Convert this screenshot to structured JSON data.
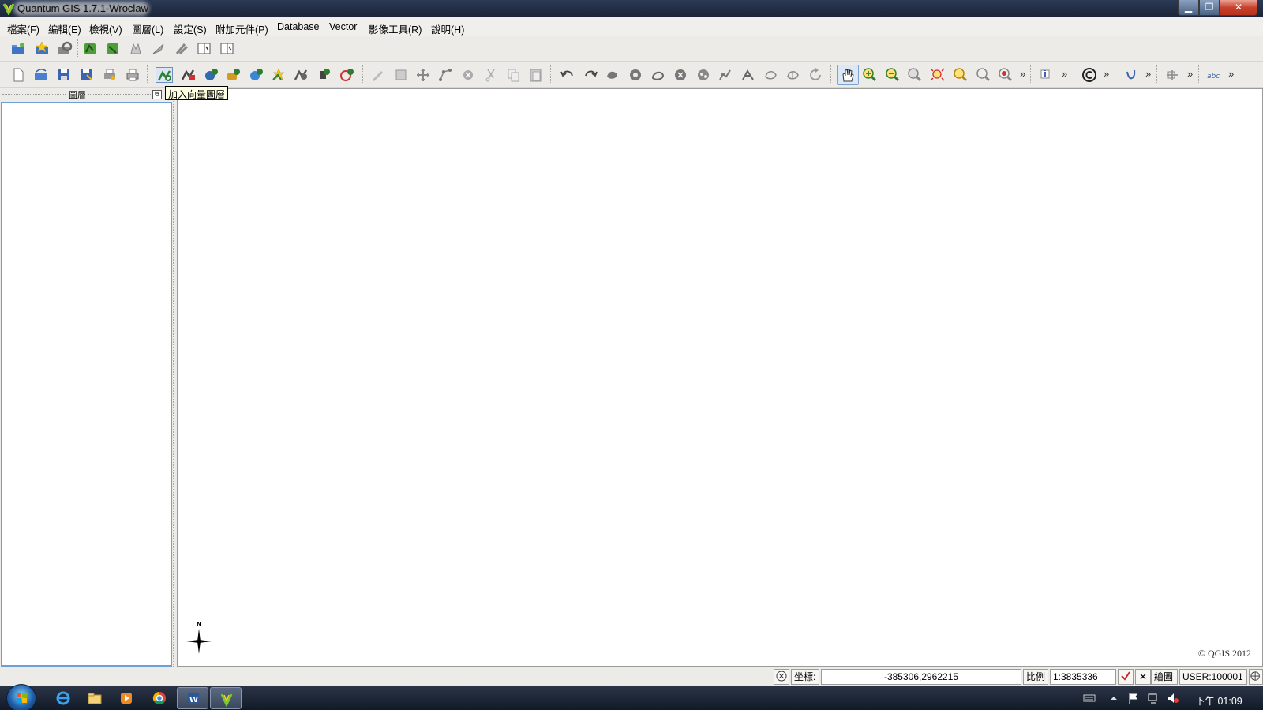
{
  "window": {
    "title": "Quantum GIS 1.7.1-Wroclaw",
    "controls": [
      "minimize",
      "maximize",
      "close"
    ]
  },
  "menubar": {
    "items": [
      {
        "label": "檔案(F)"
      },
      {
        "label": "編輯(E)"
      },
      {
        "label": "檢視(V)"
      },
      {
        "label": "圖層(L)"
      },
      {
        "label": "設定(S)"
      },
      {
        "label": "附加元件(P)"
      },
      {
        "label": "Database"
      },
      {
        "label": "Vector"
      },
      {
        "label": "影像工具(R)"
      },
      {
        "label": "說明(H)"
      }
    ]
  },
  "toolbar1": {
    "icons": [
      "open-folder-icon",
      "new-project-star-icon",
      "settings-gear-icon",
      "add-vector-green-icon",
      "add-vector-green-2-icon",
      "remove-layer-icon",
      "arrow-icon",
      "tools-icon",
      "book-icon",
      "book-2-icon"
    ]
  },
  "toolbar2": {
    "file_icons": [
      "new-file-icon",
      "open-project-icon",
      "save-icon",
      "save-as-icon",
      "print-composer-icon",
      "print-icon"
    ],
    "layer_icons": [
      "add-vector-layer-icon",
      "add-raster-layer-icon",
      "add-postgis-layer-icon",
      "add-spatialite-layer-icon",
      "add-wms-layer-icon",
      "new-shapefile-icon",
      "remove-layer-icon",
      "add-wfs-layer-icon",
      "add-plugin-layer-icon"
    ],
    "digitize_icons": [
      "pencil-icon",
      "save-edits-icon",
      "move-feature-icon",
      "node-tool-icon",
      "delete-selected-icon",
      "cut-icon",
      "copy-icon",
      "paste-icon"
    ],
    "advanced_icons": [
      "undo-icon",
      "redo-icon",
      "simplify-icon",
      "add-ring-icon",
      "add-part-icon",
      "delete-ring-icon",
      "delete-part-icon",
      "reshape-icon",
      "offset-curve-icon",
      "split-icon",
      "merge-icon",
      "merge-attributes-icon",
      "rotate-point-icon"
    ],
    "nav_icons": [
      "pan-hand-icon",
      "zoom-in-icon",
      "zoom-out-icon",
      "zoom-native-icon",
      "zoom-full-icon",
      "zoom-layer-icon",
      "zoom-selection-icon",
      "zoom-last-icon"
    ],
    "chevron": "»"
  },
  "layers_panel": {
    "title": "圖層",
    "float_button": "⧉"
  },
  "tooltip": {
    "text": "加入向量圖層"
  },
  "map": {
    "north_label": "N",
    "copyright": "© QGIS 2012"
  },
  "statusbar": {
    "coord_label": "坐標:",
    "coord_value": "-385306,2962215",
    "scale_label": "比例",
    "scale_value": "1:3835336",
    "stop_render": "✕",
    "render_label": "繪圖",
    "crs": "USER:100001"
  },
  "taskbar": {
    "apps": [
      "internet-explorer-icon",
      "file-explorer-icon",
      "media-player-icon",
      "chrome-icon",
      "word-icon",
      "qgis-icon"
    ],
    "clock": "下午 01:09"
  },
  "colors": {
    "accent": "#6f9fd8",
    "title_bar": "#1b2437",
    "tooltip_bg": "#ffffe1"
  }
}
